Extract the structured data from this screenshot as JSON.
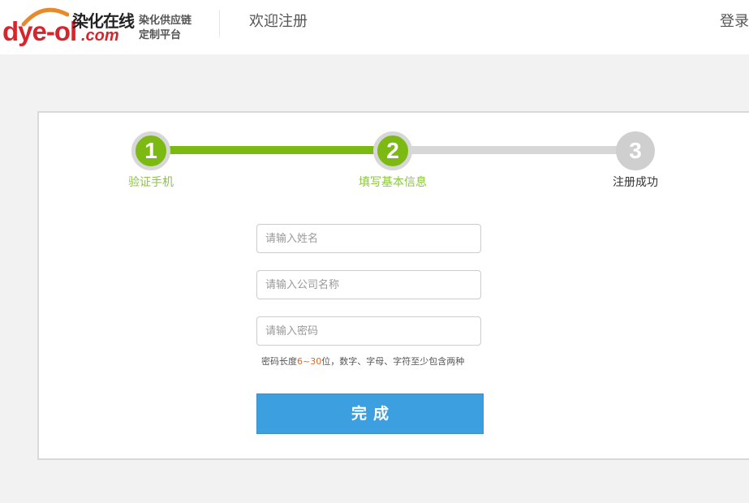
{
  "header": {
    "logo": {
      "brand_latin": "dye-ol",
      "brand_cn": "染化在线",
      "brand_domain": ".com",
      "slogan_line1": "染化供应链",
      "slogan_line2": "定制平台"
    },
    "page_title": "欢迎注册",
    "login_label": "登录"
  },
  "steps": [
    {
      "number": "1",
      "label": "验证手机",
      "state": "done"
    },
    {
      "number": "2",
      "label": "填写基本信息",
      "state": "current"
    },
    {
      "number": "3",
      "label": "注册成功",
      "state": "todo"
    }
  ],
  "form": {
    "name_placeholder": "请输入姓名",
    "company_placeholder": "请输入公司名称",
    "password_placeholder": "请输入密码",
    "password_hint_prefix": "密码长度",
    "password_hint_range": "6~30",
    "password_hint_suffix": "位，数字、字母、字符至少包含两种",
    "submit_label": "完成"
  },
  "colors": {
    "brand_red": "#d6262d",
    "step_done": "#7cba13",
    "step_todo": "#cfcfcf",
    "submit_blue": "#3c9fe0",
    "hint_highlight": "#e06a2b"
  }
}
